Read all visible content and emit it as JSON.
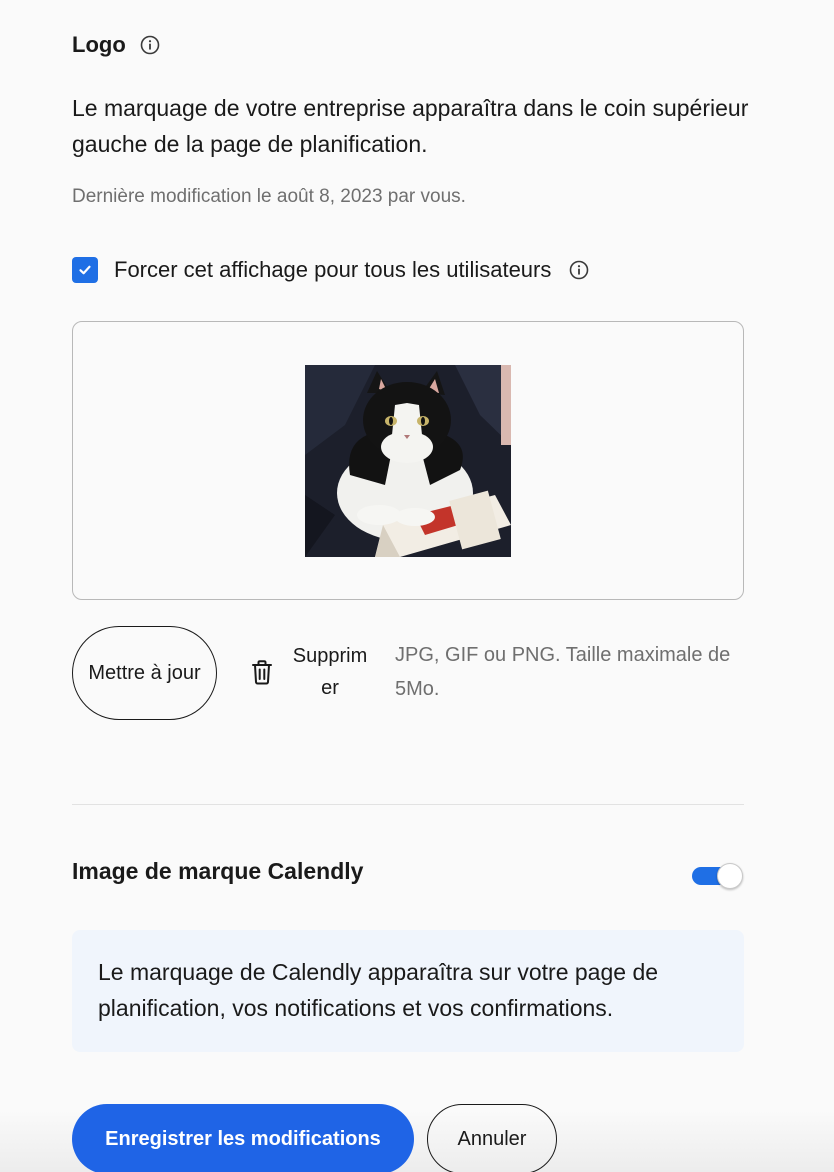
{
  "logo_section": {
    "title": "Logo",
    "description": "Le marquage de votre entreprise apparaîtra dans le coin supérieur gauche de la page de planification.",
    "last_modified": "Dernière modification le août 8, 2023 par vous.",
    "force_checkbox": {
      "label": "Forcer cet affichage pour tous les utilisateurs",
      "checked": true
    },
    "image_alt": "cat",
    "update_button": "Mettre à jour",
    "delete_button": "Supprimer",
    "hint": "JPG, GIF ou PNG. Taille maximale de 5Mo."
  },
  "brand_section": {
    "title": "Image de marque Calendly",
    "toggle_on": true,
    "note": "Le marquage de Calendly apparaîtra sur votre page de planification, vos notifications et vos confirmations."
  },
  "actions": {
    "save": "Enregistrer les modifications",
    "cancel": "Annuler"
  },
  "colors": {
    "accent": "#1f64e6",
    "note_bg": "#f0f5fc",
    "muted_text": "#6f6f6f"
  }
}
